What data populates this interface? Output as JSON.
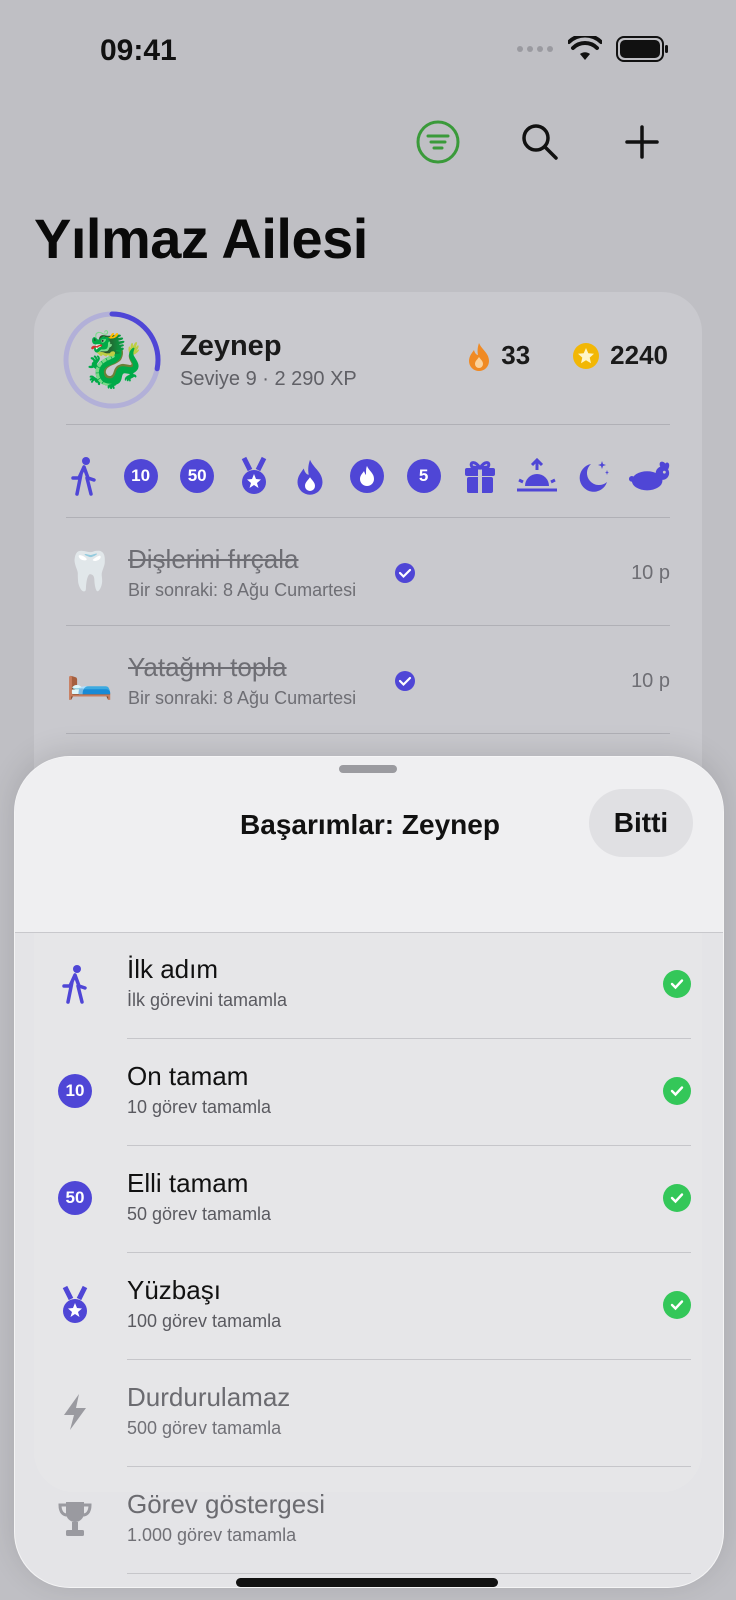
{
  "status_bar": {
    "time": "09:41"
  },
  "header": {
    "title": "Yılmaz Ailesi"
  },
  "member": {
    "avatar": "🐉",
    "name": "Zeynep",
    "subtitle": "Seviye 9 · 2 290 XP",
    "streak": "33",
    "coins": "2240",
    "level_progress": 0.28
  },
  "badges": [
    {
      "icon": "walking-figure-icon"
    },
    {
      "label": "10"
    },
    {
      "label": "50"
    },
    {
      "icon": "medal-star-icon"
    },
    {
      "icon": "flame-icon"
    },
    {
      "icon": "flame-circle-icon"
    },
    {
      "label": "5"
    },
    {
      "icon": "gift-icon"
    },
    {
      "icon": "sunrise-icon"
    },
    {
      "icon": "moon-stars-icon"
    },
    {
      "icon": "rabbit-icon"
    }
  ],
  "chores": [
    {
      "emoji": "🦷",
      "title": "Dişlerini fırçala",
      "subtitle": "Bir sonraki: 8 Ağu Cumartesi",
      "points": "10 p"
    },
    {
      "emoji": "🛏️",
      "title": "Yatağını topla",
      "subtitle": "Bir sonraki: 8 Ağu Cumartesi",
      "points": "10 p"
    }
  ],
  "sheet": {
    "title": "Başarımlar: Zeynep",
    "done_label": "Bitti",
    "achievements": [
      {
        "title": "İlk adım",
        "description": "İlk görevini tamamla",
        "icon": "walking-figure-icon",
        "unlocked": true
      },
      {
        "title": "On tamam",
        "description": "10 görev tamamla",
        "icon": "10",
        "unlocked": true
      },
      {
        "title": "Elli tamam",
        "description": "50 görev tamamla",
        "icon": "50",
        "unlocked": true
      },
      {
        "title": "Yüzbaşı",
        "description": "100 görev tamamla",
        "icon": "medal-star-icon",
        "unlocked": true
      },
      {
        "title": "Durdurulamaz",
        "description": "500 görev tamamla",
        "icon": "bolt-icon",
        "unlocked": false
      },
      {
        "title": "Görev göstergesi",
        "description": "1.000 görev tamamla",
        "icon": "trophy-icon",
        "unlocked": false
      }
    ]
  },
  "colors": {
    "accent": "#4f46d6",
    "success": "#34c759",
    "filter": "#3a9a3a",
    "flame": "#f08a24",
    "coin": "#f2b705"
  }
}
